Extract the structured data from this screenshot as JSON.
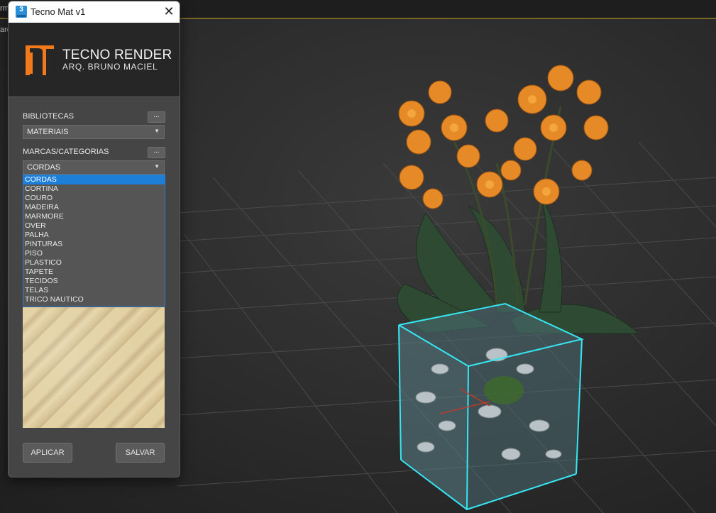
{
  "viewport": {
    "corner_text_1": "rm",
    "corner_text_2": "ard"
  },
  "dialog": {
    "app_icon_label": "3",
    "title": "Tecno Mat v1",
    "close_glyph": "✕",
    "brand": {
      "name": "TECNO RENDER",
      "subtitle": "ARQ. BRUNO MACIEL",
      "accent_color": "#f27a1a"
    },
    "libraries": {
      "label": "BIBLIOTECAS",
      "browse_label": "...",
      "selected": "MATERIAIS"
    },
    "categories": {
      "label": "MARCAS/CATEGORIAS",
      "browse_label": "...",
      "selected": "CORDAS",
      "options": [
        "CORDAS",
        "CORTINA",
        "COURO",
        "MADEIRA",
        "MARMORE",
        "OVER",
        "PALHA",
        "PINTURAS",
        "PISO",
        "PLASTICO",
        "TAPETE",
        "TECIDOS",
        "TELAS",
        "TRICO NAUTICO"
      ]
    },
    "buttons": {
      "apply": "APLICAR",
      "save": "SALVAR"
    }
  },
  "colors": {
    "selection": "#1e7fd9",
    "gizmo": "#36e6f2"
  }
}
